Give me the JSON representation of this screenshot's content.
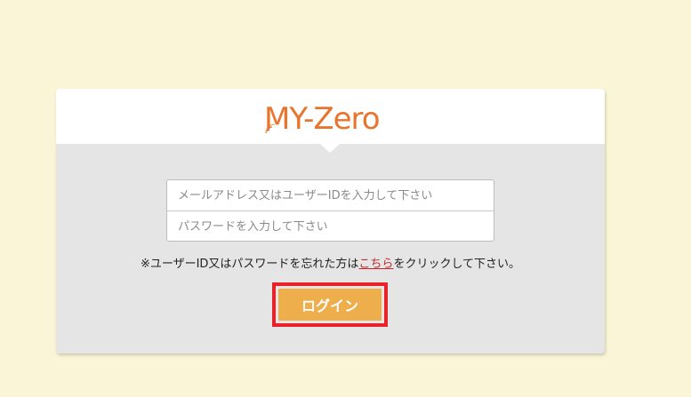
{
  "logo": {
    "text": "MY-Zero"
  },
  "form": {
    "email_placeholder": "メールアドレス又はユーザーIDを入力して下さい",
    "password_placeholder": "パスワードを入力して下さい"
  },
  "notice": {
    "prefix": "※ユーザーID又はパスワードを忘れた方は",
    "link": "こちら",
    "suffix": "をクリックして下さい。"
  },
  "login_button": {
    "label": "ログイン"
  },
  "colors": {
    "background": "#faf5d6",
    "brand_orange": "#e8742e",
    "button": "#eeae4c",
    "highlight_border": "#e8212a",
    "link": "#c0282d"
  }
}
